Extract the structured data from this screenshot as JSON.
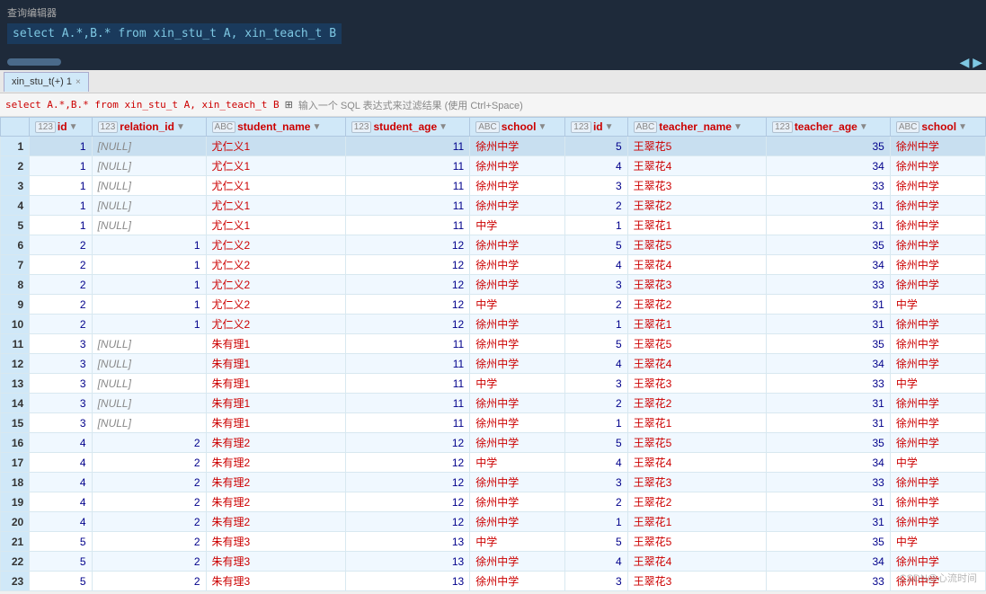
{
  "editor": {
    "title": "查询编辑器",
    "sql": "select A.*,B.* from xin_stu_t A, xin_teach_t B"
  },
  "tab": {
    "label": "xin_stu_t(+) 1",
    "close": "×"
  },
  "filter_bar": {
    "sql_text": "select A.*,B.* from xin_stu_t A, xin_teach_t B",
    "hint": "输入一个 SQL 表达式来过滤结果 (使用 Ctrl+Space)"
  },
  "columns": [
    {
      "type": "123",
      "name": "id",
      "filter": true
    },
    {
      "type": "123",
      "name": "relation_id",
      "filter": true
    },
    {
      "type": "ABC",
      "name": "student_name",
      "filter": true
    },
    {
      "type": "123",
      "name": "student_age",
      "filter": true
    },
    {
      "type": "ABC",
      "name": "school",
      "filter": true
    },
    {
      "type": "123",
      "name": "id",
      "filter": true
    },
    {
      "type": "ABC",
      "name": "teacher_name",
      "filter": true
    },
    {
      "type": "123",
      "name": "teacher_age",
      "filter": true
    },
    {
      "type": "ABC",
      "name": "school",
      "filter": true
    }
  ],
  "rows": [
    [
      1,
      1,
      null,
      "尤仁义1",
      11,
      "徐州中学",
      5,
      "王翠花5",
      35,
      "徐州中学"
    ],
    [
      2,
      1,
      null,
      "尤仁义1",
      11,
      "徐州中学",
      4,
      "王翠花4",
      34,
      "徐州中学"
    ],
    [
      3,
      1,
      null,
      "尤仁义1",
      11,
      "徐州中学",
      3,
      "王翠花3",
      33,
      "徐州中学"
    ],
    [
      4,
      1,
      null,
      "尤仁义1",
      11,
      "徐州中学",
      2,
      "王翠花2",
      31,
      "徐州中学"
    ],
    [
      5,
      1,
      null,
      "尤仁义1",
      11,
      "中学",
      1,
      "王翠花1",
      31,
      "徐州中学"
    ],
    [
      6,
      2,
      1,
      "尤仁义2",
      12,
      "徐州中学",
      5,
      "王翠花5",
      35,
      "徐州中学"
    ],
    [
      7,
      2,
      1,
      "尤仁义2",
      12,
      "徐州中学",
      4,
      "王翠花4",
      34,
      "徐州中学"
    ],
    [
      8,
      2,
      1,
      "尤仁义2",
      12,
      "徐州中学",
      3,
      "王翠花3",
      33,
      "徐州中学"
    ],
    [
      9,
      2,
      1,
      "尤仁义2",
      12,
      "中学",
      2,
      "王翠花2",
      31,
      "中学"
    ],
    [
      10,
      2,
      1,
      "尤仁义2",
      12,
      "徐州中学",
      1,
      "王翠花1",
      31,
      "徐州中学"
    ],
    [
      11,
      3,
      null,
      "朱有理1",
      11,
      "徐州中学",
      5,
      "王翠花5",
      35,
      "徐州中学"
    ],
    [
      12,
      3,
      null,
      "朱有理1",
      11,
      "徐州中学",
      4,
      "王翠花4",
      34,
      "徐州中学"
    ],
    [
      13,
      3,
      null,
      "朱有理1",
      11,
      "中学",
      3,
      "王翠花3",
      33,
      "中学"
    ],
    [
      14,
      3,
      null,
      "朱有理1",
      11,
      "徐州中学",
      2,
      "王翠花2",
      31,
      "徐州中学"
    ],
    [
      15,
      3,
      null,
      "朱有理1",
      11,
      "徐州中学",
      1,
      "王翠花1",
      31,
      "徐州中学"
    ],
    [
      16,
      4,
      2,
      "朱有理2",
      12,
      "徐州中学",
      5,
      "王翠花5",
      35,
      "徐州中学"
    ],
    [
      17,
      4,
      2,
      "朱有理2",
      12,
      "中学",
      4,
      "王翠花4",
      34,
      "中学"
    ],
    [
      18,
      4,
      2,
      "朱有理2",
      12,
      "徐州中学",
      3,
      "王翠花3",
      33,
      "徐州中学"
    ],
    [
      19,
      4,
      2,
      "朱有理2",
      12,
      "徐州中学",
      2,
      "王翠花2",
      31,
      "徐州中学"
    ],
    [
      20,
      4,
      2,
      "朱有理2",
      12,
      "徐州中学",
      1,
      "王翠花1",
      31,
      "徐州中学"
    ],
    [
      21,
      5,
      2,
      "朱有理3",
      13,
      "中学",
      5,
      "王翠花5",
      35,
      "中学"
    ],
    [
      22,
      5,
      2,
      "朱有理3",
      13,
      "徐州中学",
      4,
      "王翠花4",
      34,
      "徐州中学"
    ],
    [
      23,
      5,
      2,
      "朱有理3",
      13,
      "徐州中学",
      3,
      "王翠花3",
      33,
      "徐州中学"
    ]
  ],
  "watermark": "CSDN@心流时间"
}
